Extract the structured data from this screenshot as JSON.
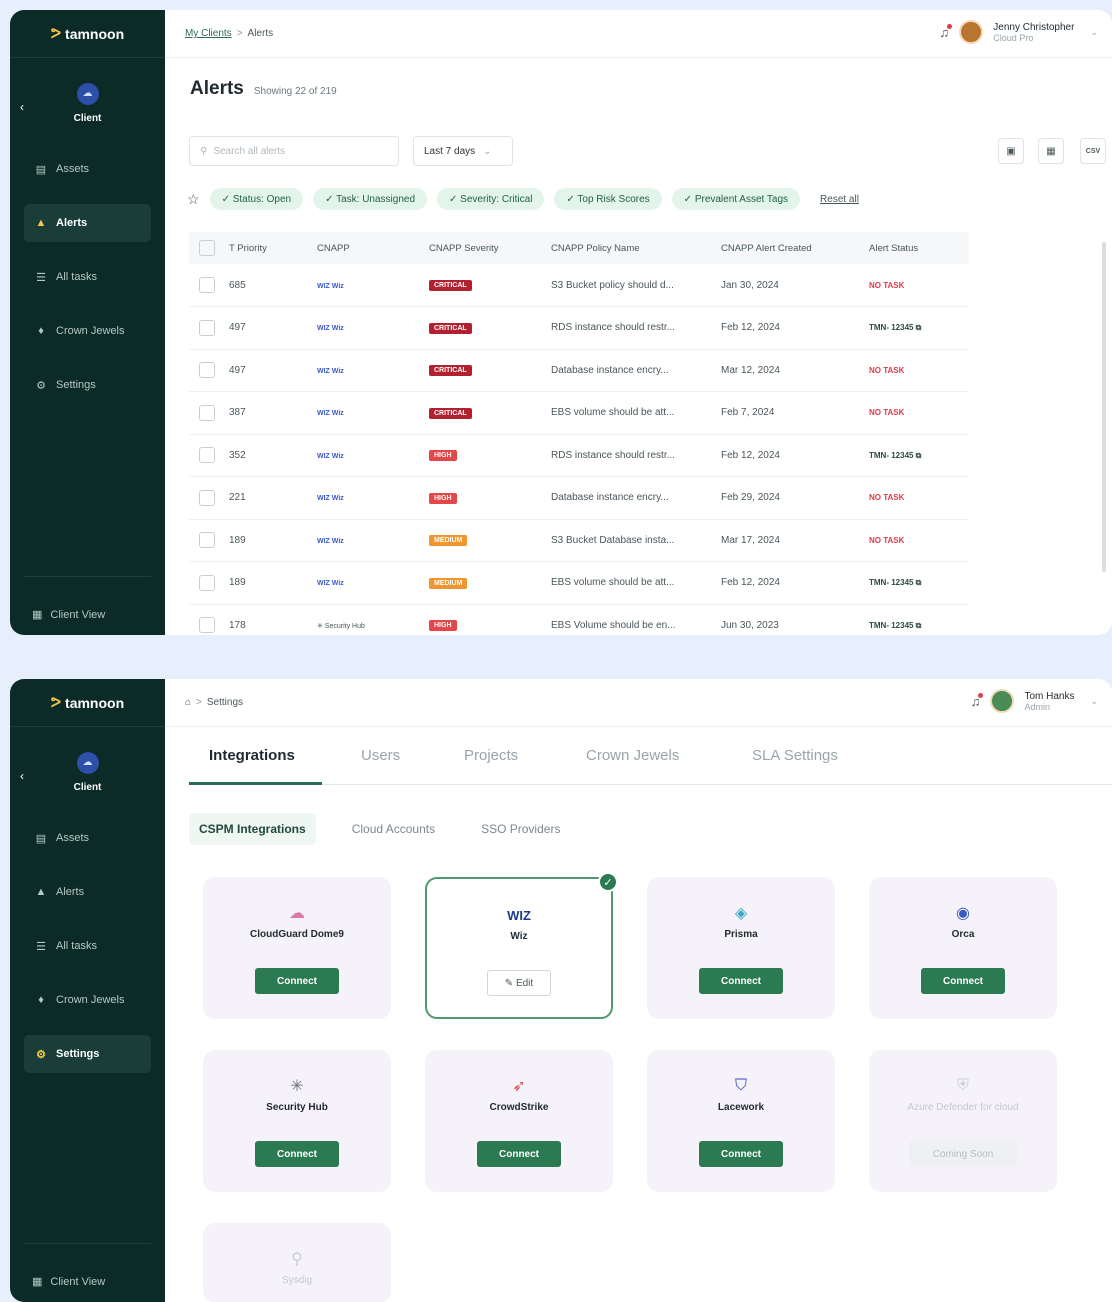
{
  "brand": {
    "name": "tamnoon",
    "mark": "ᕗ"
  },
  "sidebar": {
    "client_label": "Client",
    "back": "‹",
    "items": [
      {
        "icon": "▤",
        "label": "Assets"
      },
      {
        "icon": "▲",
        "label": "Alerts"
      },
      {
        "icon": "☰",
        "label": "All tasks"
      },
      {
        "icon": "♦",
        "label": "Crown Jewels"
      },
      {
        "icon": "⚙",
        "label": "Settings"
      }
    ],
    "client_view": {
      "icon": "▦",
      "label": "Client View"
    }
  },
  "alerts": {
    "breadcrumb": {
      "parent": "My Clients",
      "sep": ">",
      "current": "Alerts"
    },
    "user": {
      "name": "Jenny Christopher",
      "role": "Cloud Pro"
    },
    "title": "Alerts",
    "showing": "Showing 22 of 219",
    "search_placeholder": "Search all alerts",
    "range": "Last 7 days",
    "caret": "⌄",
    "tools": [
      "▣",
      "▦",
      "CSV"
    ],
    "filters": [
      "✓ Status: Open",
      "✓ Task: Unassigned",
      "✓ Severity: Critical",
      "✓ Top Risk Scores",
      "✓ Prevalent Asset Tags"
    ],
    "reset": "Reset all",
    "columns": [
      "T Priority",
      "CNAPP",
      "CNAPP Severity",
      "CNAPP Policy Name",
      "CNAPP Alert Created",
      "Alert Status"
    ],
    "rows": [
      {
        "priority": "685",
        "cnapp": "WIZ Wiz",
        "severity": "CRITICAL",
        "policy": "S3 Bucket policy should d...",
        "created": "Jan 30, 2024",
        "status": "NO TASK"
      },
      {
        "priority": "497",
        "cnapp": "WIZ Wiz",
        "severity": "CRITICAL",
        "policy": "RDS instance should restr...",
        "created": "Feb 12, 2024",
        "status": "TMN- 12345 ⧉"
      },
      {
        "priority": "497",
        "cnapp": "WIZ Wiz",
        "severity": "CRITICAL",
        "policy": "Database instance encry...",
        "created": "Mar 12, 2024",
        "status": "NO TASK"
      },
      {
        "priority": "387",
        "cnapp": "WIZ Wiz",
        "severity": "CRITICAL",
        "policy": "EBS volume should be att...",
        "created": "Feb 7, 2024",
        "status": "NO TASK"
      },
      {
        "priority": "352",
        "cnapp": "WIZ Wiz",
        "severity": "HIGH",
        "policy": "RDS instance should restr...",
        "created": "Feb 12, 2024",
        "status": "TMN- 12345 ⧉"
      },
      {
        "priority": "221",
        "cnapp": "WIZ Wiz",
        "severity": "HIGH",
        "policy": "Database instance encry...",
        "created": "Feb 29, 2024",
        "status": "NO TASK"
      },
      {
        "priority": "189",
        "cnapp": "WIZ Wiz",
        "severity": "MEDIUM",
        "policy": "S3 Bucket Database insta...",
        "created": "Mar 17, 2024",
        "status": "NO TASK"
      },
      {
        "priority": "189",
        "cnapp": "WIZ Wiz",
        "severity": "MEDIUM",
        "policy": "EBS volume should be att...",
        "created": "Feb 12, 2024",
        "status": "TMN- 12345 ⧉"
      },
      {
        "priority": "178",
        "cnapp": "✳ Security Hub",
        "severity": "HIGH",
        "policy": "EBS Volume should be en...",
        "created": "Jun 30, 2023",
        "status": "TMN- 12345 ⧉"
      }
    ],
    "severity_colors": {
      "CRITICAL": "#b3202f",
      "HIGH": "#e4474a",
      "MEDIUM": "#f0962f"
    }
  },
  "settings": {
    "breadcrumb": {
      "home": "⌂",
      "sep": ">",
      "current": "Settings"
    },
    "user": {
      "name": "Tom Hanks",
      "role": "Admin"
    },
    "tabs": [
      "Integrations",
      "Users",
      "Projects",
      "Crown Jewels",
      "SLA Settings"
    ],
    "subtabs": [
      "CSPM Integrations",
      "Cloud Accounts",
      "SSO Providers"
    ],
    "cards": [
      {
        "name": "CloudGuard Dome9",
        "icon": "☁",
        "color": "#d97aa8",
        "button": "Connect",
        "state": "connect"
      },
      {
        "name": "Wiz",
        "icon": "WIZ",
        "color": "#1f3a8a",
        "button": "✎ Edit",
        "state": "selected"
      },
      {
        "name": "Prisma",
        "icon": "◈",
        "color": "#3aa8c4",
        "button": "Connect",
        "state": "connect"
      },
      {
        "name": "Orca",
        "icon": "◉",
        "color": "#3b5bc4",
        "button": "Connect",
        "state": "connect"
      },
      {
        "name": "Security Hub",
        "icon": "✳",
        "color": "#6c7478",
        "button": "Connect",
        "state": "connect"
      },
      {
        "name": "CrowdStrike",
        "icon": "➶",
        "color": "#d84a4a",
        "button": "Connect",
        "state": "connect"
      },
      {
        "name": "Lacework",
        "icon": "⛉",
        "color": "#3b48b8",
        "button": "Connect",
        "state": "connect"
      },
      {
        "name": "Azure Defender for cloud",
        "icon": "⛨",
        "color": "#c9cfd2",
        "button": "Coming Soon",
        "state": "soon"
      },
      {
        "name": "Sysdig",
        "icon": "⚲",
        "color": "#c9cfd2",
        "button": "",
        "state": "disabled"
      }
    ]
  }
}
